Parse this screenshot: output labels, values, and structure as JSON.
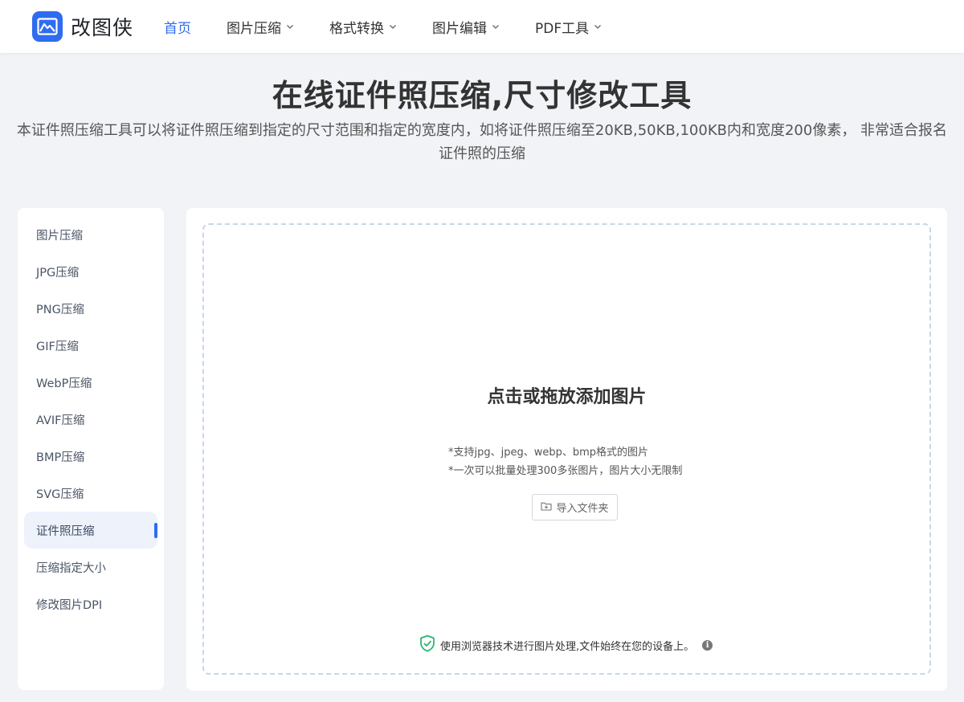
{
  "header": {
    "brand_name": "改图侠",
    "nav": [
      {
        "label": "首页",
        "active": true,
        "has_dropdown": false
      },
      {
        "label": "图片压缩",
        "active": false,
        "has_dropdown": true
      },
      {
        "label": "格式转换",
        "active": false,
        "has_dropdown": true
      },
      {
        "label": "图片编辑",
        "active": false,
        "has_dropdown": true
      },
      {
        "label": "PDF工具",
        "active": false,
        "has_dropdown": true
      }
    ]
  },
  "hero": {
    "title": "在线证件照压缩,尺寸修改工具",
    "description": "本证件照压缩工具可以将证件照压缩到指定的尺寸范围和指定的宽度内，如将证件照压缩至20KB,50KB,100KB内和宽度200像素， 非常适合报名证件照的压缩"
  },
  "sidebar": {
    "items": [
      {
        "label": "图片压缩"
      },
      {
        "label": "JPG压缩"
      },
      {
        "label": "PNG压缩"
      },
      {
        "label": "GIF压缩"
      },
      {
        "label": "WebP压缩"
      },
      {
        "label": "AVIF压缩"
      },
      {
        "label": "BMP压缩"
      },
      {
        "label": "SVG压缩"
      },
      {
        "label": "证件照压缩",
        "active": true
      },
      {
        "label": "压缩指定大小"
      },
      {
        "label": "修改图片DPI"
      }
    ]
  },
  "dropzone": {
    "title": "点击或拖放添加图片",
    "notes": [
      "*支持jpg、jpeg、webp、bmp格式的图片",
      "*一次可以批量处理300多张图片，图片大小无限制"
    ],
    "folder_button": "导入文件夹",
    "privacy_note": "使用浏览器技术进行图片处理,文件始终在您的设备上。"
  },
  "colors": {
    "accent": "#2f6cf0",
    "page_bg": "#f1f3f6",
    "shield": "#2bb673"
  },
  "icons": {
    "logo": "mountain-photo-icon",
    "dropdown": "chevron-down-icon",
    "folder": "folder-icon",
    "shield": "shield-check-icon",
    "info": "info-icon"
  }
}
